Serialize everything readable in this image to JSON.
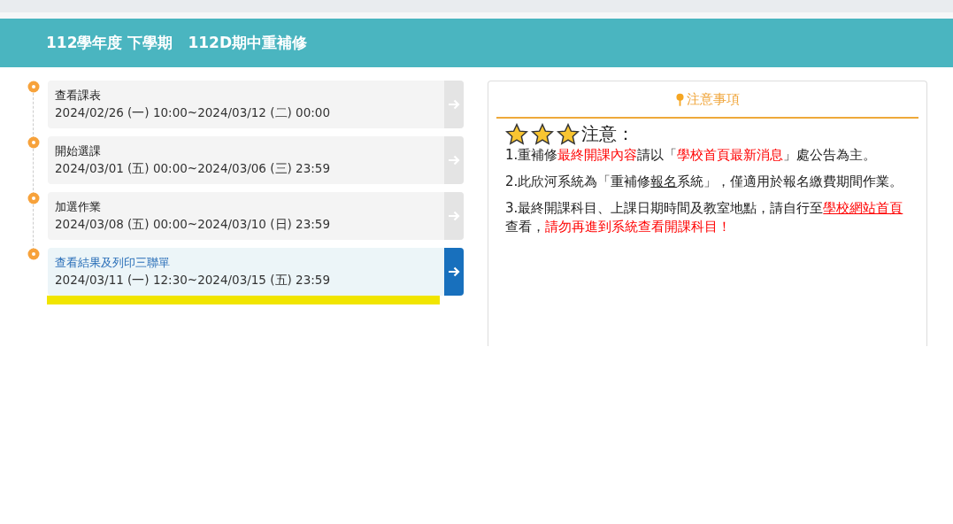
{
  "header": {
    "title": "112學年度 下學期　112D期中重補修"
  },
  "steps": [
    {
      "title": "查看課表",
      "period": "2024/02/26 (一) 10:00~2024/03/12 (二) 00:00",
      "selected": false
    },
    {
      "title": "開始選課",
      "period": "2024/03/01 (五) 00:00~2024/03/06 (三) 23:59",
      "selected": false
    },
    {
      "title": "加選作業",
      "period": "2024/03/08 (五) 00:00~2024/03/10 (日) 23:59",
      "selected": false
    },
    {
      "title": "查看結果及列印三聯單",
      "period": "2024/03/11 (一) 12:30~2024/03/15 (五) 23:59",
      "selected": true
    }
  ],
  "notice": {
    "title": "注意事項",
    "stars": 3,
    "heading": "注意：",
    "paragraphs": [
      [
        {
          "kind": "plain",
          "text": "1.重補修"
        },
        {
          "kind": "red",
          "text": "最終開課內容"
        },
        {
          "kind": "plain",
          "text": "請以「"
        },
        {
          "kind": "red",
          "text": "學校首頁最新消息"
        },
        {
          "kind": "plain",
          "text": "」處公告為主。"
        }
      ],
      [
        {
          "kind": "plain",
          "text": "2.此欣河系統為「重補修"
        },
        {
          "kind": "underline",
          "text": "報名"
        },
        {
          "kind": "plain",
          "text": "系統」，僅適用於報名繳費期間作業。"
        }
      ],
      [
        {
          "kind": "plain",
          "text": "3.最終開課科目、上課日期時間及教室地點，請自行至"
        },
        {
          "kind": "link",
          "text": "學校網站首頁"
        },
        {
          "kind": "plain",
          "text": "查看，"
        },
        {
          "kind": "red",
          "text": "請勿再進到系統查看開課科目！"
        }
      ]
    ]
  }
}
